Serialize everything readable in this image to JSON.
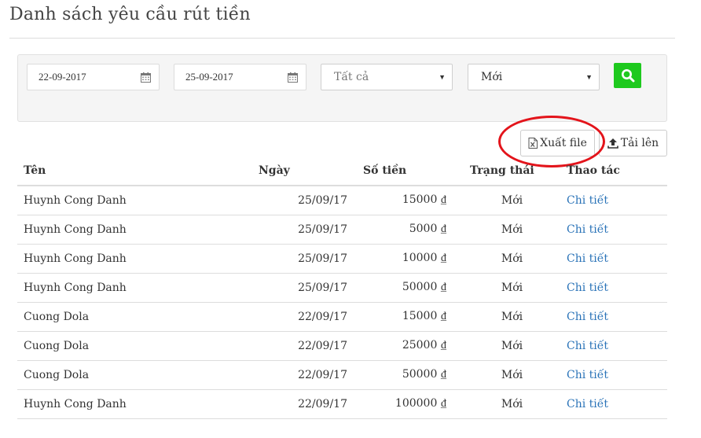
{
  "page": {
    "title": "Danh sách yêu cầu rút tiền"
  },
  "filters": {
    "from_date": "22-09-2017",
    "to_date": "25-09-2017",
    "type_select": "Tất cả",
    "status_select": "Mới"
  },
  "actions": {
    "export_label": "Xuất file",
    "upload_label": "Tải lên"
  },
  "table": {
    "headers": [
      "Tên",
      "Ngày",
      "Số tiền",
      "Trạng thái",
      "Thao tác"
    ],
    "rows": [
      {
        "name": "Huynh Cong Danh",
        "date": "25/09/17",
        "amount": "15000 ₫",
        "status": "Mới",
        "action": "Chi tiết"
      },
      {
        "name": "Huynh Cong Danh",
        "date": "25/09/17",
        "amount": "5000 ₫",
        "status": "Mới",
        "action": "Chi tiết"
      },
      {
        "name": "Huynh Cong Danh",
        "date": "25/09/17",
        "amount": "10000 ₫",
        "status": "Mới",
        "action": "Chi tiết"
      },
      {
        "name": "Huynh Cong Danh",
        "date": "25/09/17",
        "amount": "50000 ₫",
        "status": "Mới",
        "action": "Chi tiết"
      },
      {
        "name": "Cuong Dola",
        "date": "22/09/17",
        "amount": "15000 ₫",
        "status": "Mới",
        "action": "Chi tiết"
      },
      {
        "name": "Cuong Dola",
        "date": "22/09/17",
        "amount": "25000 ₫",
        "status": "Mới",
        "action": "Chi tiết"
      },
      {
        "name": "Cuong Dola",
        "date": "22/09/17",
        "amount": "50000 ₫",
        "status": "Mới",
        "action": "Chi tiết"
      },
      {
        "name": "Huynh Cong Danh",
        "date": "22/09/17",
        "amount": "100000 ₫",
        "status": "Mới",
        "action": "Chi tiết"
      }
    ]
  },
  "icons": {
    "calendar": "calendar-icon",
    "search": "search-icon",
    "excel": "excel-file-icon",
    "upload": "upload-icon",
    "caret": "caret-down-icon"
  },
  "colors": {
    "search_button": "#1ec91e",
    "link": "#2a73b8",
    "highlight": "#e3141b"
  }
}
